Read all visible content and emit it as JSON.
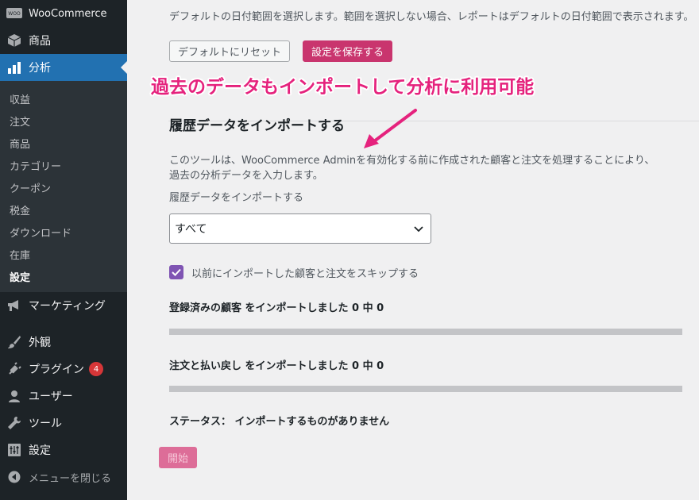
{
  "sidebar": {
    "woocommerce": "WooCommerce",
    "products": "商品",
    "analytics": "分析",
    "submenu": [
      "収益",
      "注文",
      "商品",
      "カテゴリー",
      "クーポン",
      "税金",
      "ダウンロード",
      "在庫",
      "設定"
    ],
    "marketing": "マーケティング",
    "appearance": "外観",
    "plugins": "プラグイン",
    "plugins_badge": "4",
    "users": "ユーザー",
    "tools": "ツール",
    "settings": "設定",
    "collapse": "メニューを閉じる"
  },
  "main": {
    "date_desc": "デフォルトの日付範囲を選択します。範囲を選択しない場合、レポートはデフォルトの日付範囲で表示されます。",
    "reset_button": "デフォルトにリセット",
    "save_button": "設定を保存する",
    "annotation": "過去のデータもインポートして分析に利用可能",
    "section_title": "履歴データをインポートする",
    "tool_desc_1": "このツールは、WooCommerce Adminを有効化する前に作成された顧客と注文を処理することにより、",
    "tool_desc_2": "過去の分析データを入力します。",
    "select_label": "履歴データをインポートする",
    "select_value": "すべて",
    "skip_label": "以前にインポートした顧客と注文をスキップする",
    "customers_label": "登録済みの顧客 をインポートしました 0 中 0",
    "customers_progress": 0,
    "orders_label": "注文と払い戻し をインポートしました 0 中 0",
    "orders_progress": 0,
    "status": "ステータス： インポートするものがありません",
    "start_button": "開始"
  },
  "colors": {
    "accent": "#2271b1",
    "woo_purple": "#7f54b3",
    "save_pink": "#c9356e",
    "annotation": "#e5227d"
  }
}
